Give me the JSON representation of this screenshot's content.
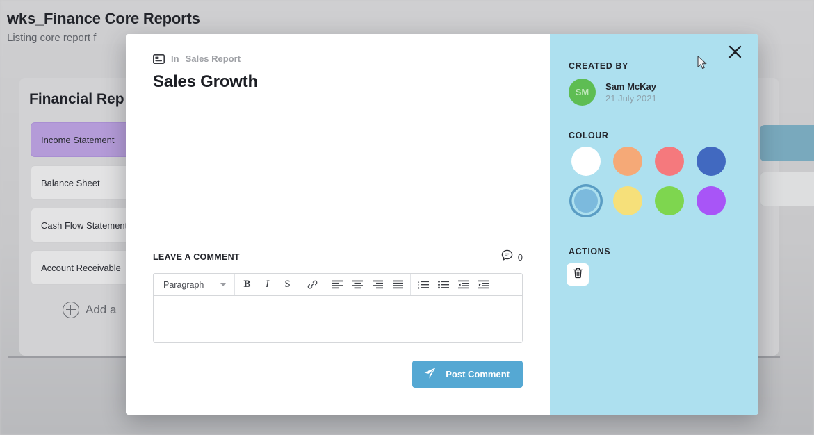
{
  "background": {
    "page_title": "wks_Finance Core Reports",
    "page_subtitle": "Listing core report f",
    "card_title": "Financial Rep",
    "list_items": [
      {
        "label": "Income Statement",
        "selected": true
      },
      {
        "label": "Balance Sheet",
        "selected": false
      },
      {
        "label": "Cash Flow Statement",
        "selected": false
      },
      {
        "label": "Account Receivable",
        "selected": false
      }
    ],
    "add_label": "Add a",
    "selected_item_color": "#b49bd8"
  },
  "modal": {
    "breadcrumb": {
      "prefix": "In",
      "link": "Sales Report",
      "icon": "report-card-icon"
    },
    "title": "Sales Growth",
    "comment": {
      "label": "LEAVE A COMMENT",
      "count": "0",
      "count_icon": "comment-bubble-icon",
      "editor": {
        "style_select_value": "Paragraph",
        "style_options": [
          "Paragraph"
        ],
        "tools": [
          {
            "name": "bold-button",
            "glyph": "B"
          },
          {
            "name": "italic-button",
            "glyph": "I"
          },
          {
            "name": "strikethrough-button",
            "glyph": "S"
          },
          {
            "name": "link-button",
            "glyph": "link-icon"
          },
          {
            "name": "align-left-button",
            "glyph": "align-left-icon"
          },
          {
            "name": "align-center-button",
            "glyph": "align-center-icon"
          },
          {
            "name": "align-right-button",
            "glyph": "align-right-icon"
          },
          {
            "name": "align-justify-button",
            "glyph": "align-justify-icon"
          },
          {
            "name": "ordered-list-button",
            "glyph": "ordered-list-icon"
          },
          {
            "name": "unordered-list-button",
            "glyph": "unordered-list-icon"
          },
          {
            "name": "outdent-button",
            "glyph": "outdent-icon"
          },
          {
            "name": "indent-button",
            "glyph": "indent-icon"
          }
        ],
        "body_value": "",
        "body_placeholder": ""
      },
      "post_button": "Post Comment",
      "post_button_icon": "send-paper-plane-icon",
      "post_button_color": "#55a8d3"
    },
    "sidebar": {
      "close_icon": "close-icon",
      "created_by_label": "CREATED BY",
      "author": {
        "initials": "SM",
        "name": "Sam McKay",
        "date": "21 July 2021",
        "avatar_color": "#5ebd53"
      },
      "colour_label": "COLOUR",
      "swatches": [
        {
          "name": "swatch-white",
          "color": "#ffffff",
          "selected": false
        },
        {
          "name": "swatch-orange",
          "color": "#f5a977",
          "selected": false
        },
        {
          "name": "swatch-red",
          "color": "#f5797d",
          "selected": false
        },
        {
          "name": "swatch-blue",
          "color": "#4169c0",
          "selected": false
        },
        {
          "name": "swatch-light-blue",
          "color": "#7cbadd",
          "selected": true
        },
        {
          "name": "swatch-yellow",
          "color": "#f6e07a",
          "selected": false
        },
        {
          "name": "swatch-green",
          "color": "#7ed64f",
          "selected": false
        },
        {
          "name": "swatch-purple",
          "color": "#a855f7",
          "selected": false
        }
      ],
      "actions_label": "ACTIONS",
      "delete_icon": "trash-icon",
      "panel_color": "#ade0ef"
    }
  }
}
